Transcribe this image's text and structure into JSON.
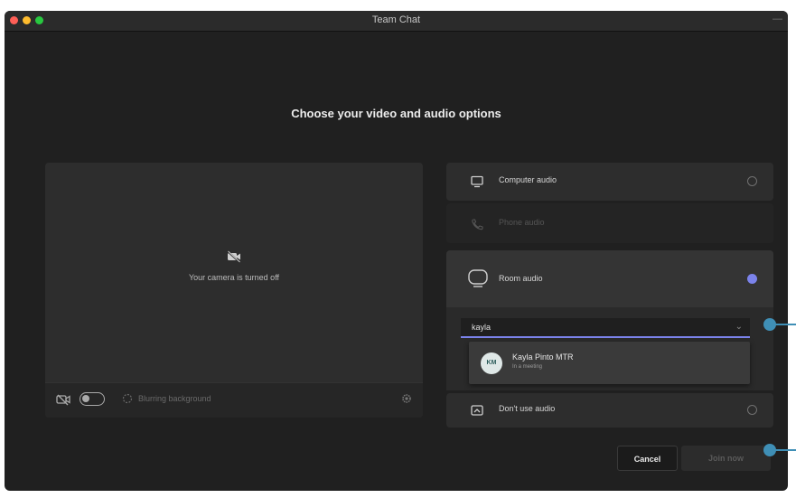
{
  "window": {
    "title": "Team Chat"
  },
  "heading": "Choose your video and audio options",
  "preview": {
    "camera_off_text": "Your camera is turned off",
    "blur_text": "Blurring background"
  },
  "audio_options": {
    "computer": {
      "label": "Computer audio",
      "selected": false
    },
    "phone": {
      "label": "Phone audio",
      "selected": false,
      "disabled": true
    },
    "room": {
      "label": "Room audio",
      "selected": true,
      "search_value": "kayla",
      "suggestion": {
        "initials": "KM",
        "name": "Kayla Pinto MTR",
        "status": "In a meeting"
      }
    },
    "none": {
      "label": "Don't use audio",
      "selected": false
    }
  },
  "buttons": {
    "cancel": "Cancel",
    "join": "Join now"
  },
  "colors": {
    "accent": "#7b83eb",
    "callout": "#3f8fb6",
    "window_bg": "#202020"
  }
}
